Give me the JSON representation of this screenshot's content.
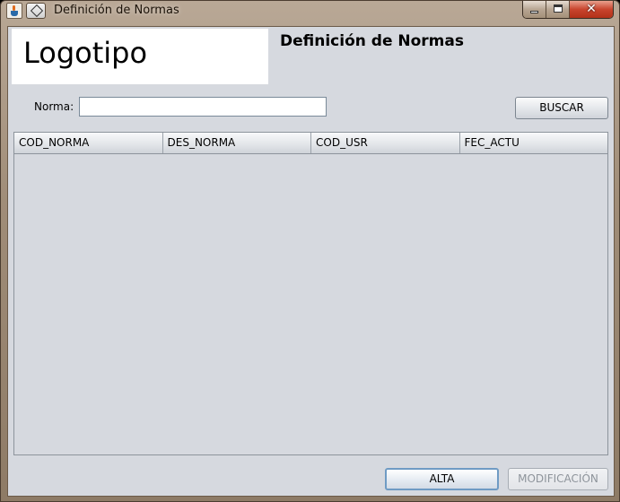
{
  "window": {
    "title": "Definición de Normas"
  },
  "header": {
    "logo_text": "Logotipo",
    "form_title": "Definición de Normas"
  },
  "search": {
    "label": "Norma:",
    "value": "",
    "placeholder": "",
    "button_label": "BUSCAR"
  },
  "table": {
    "columns": [
      "COD_NORMA",
      "DES_NORMA",
      "COD_USR",
      "FEC_ACTU"
    ],
    "rows": []
  },
  "actions": {
    "alta_label": "ALTA",
    "modificacion_label": "MODIFICACIÓN"
  },
  "icons": {
    "app_icon": "java-cup-icon",
    "system_menu": "system-menu-icon",
    "minimize": "minimize-icon",
    "maximize": "maximize-icon",
    "close": "close-icon"
  },
  "colors": {
    "panel_background": "#d6d9df",
    "title_bar": "#a08d78",
    "close_button": "#c8442d",
    "disabled_text": "#8e949b",
    "focused_border": "#6f9bc4"
  }
}
